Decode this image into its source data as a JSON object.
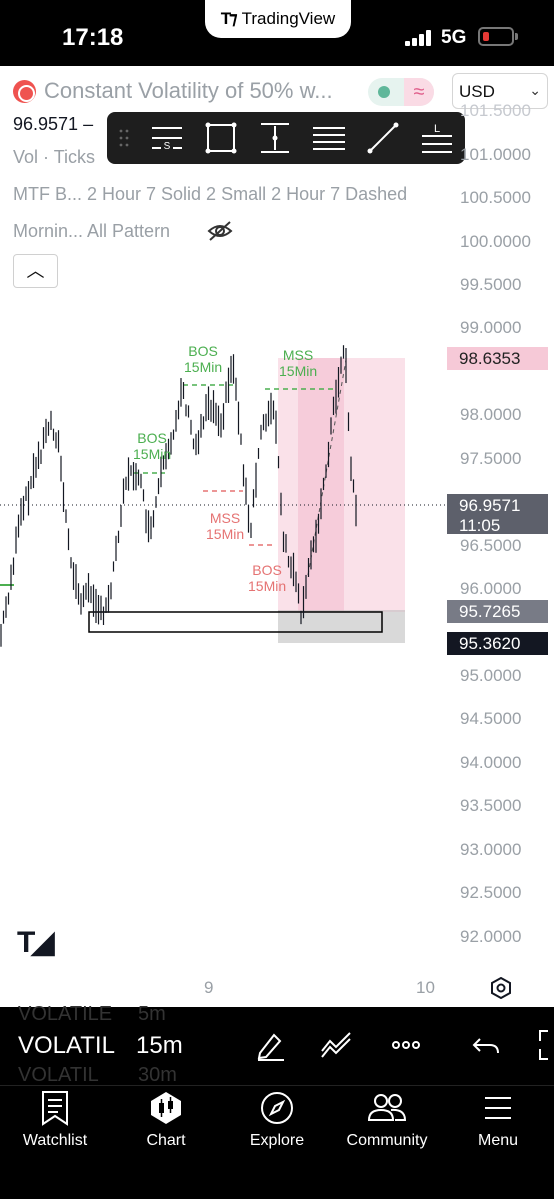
{
  "status_bar": {
    "time": "17:18",
    "network": "5G",
    "app_name": "TradingView"
  },
  "symbol": {
    "title": "Constant Volatility of 50% w...",
    "price": "96.9571",
    "price_suffix": "–",
    "volume_line": "Vol · Ticks",
    "indicator_line": "MTF B...  2 Hour 7 Solid 2 Small 2 Hour 7 Dashed",
    "indicator_line_2": "Mornin...   All Pattern"
  },
  "currency": "USD",
  "drawing_toolbar": {
    "tools": [
      "horizontal-lines-s-icon",
      "rectangle-icon",
      "vertical-range-icon",
      "parallel-lines-icon",
      "trend-line-icon",
      "horizontal-lines-l-icon"
    ]
  },
  "price_axis": {
    "labels": [
      "101.0000",
      "100.5000",
      "100.0000",
      "99.5000",
      "99.0000",
      "98.0000",
      "97.5000",
      "96.5000",
      "96.0000",
      "95.0000",
      "94.5000",
      "94.0000",
      "93.5000",
      "93.0000",
      "92.5000",
      "92.0000"
    ],
    "partial_top": "101.5000"
  },
  "price_tags": {
    "high": "98.6353",
    "current": "96.9571",
    "countdown": "11:05",
    "level_a": "95.7265",
    "level_b": "95.3620"
  },
  "time_axis": [
    "9",
    "10"
  ],
  "annotations": {
    "bos_1": [
      "BOS",
      "15Min"
    ],
    "bos_2": [
      "BOS",
      "15Min"
    ],
    "mss_green": [
      "MSS",
      "15Min"
    ],
    "mss_red": [
      "MSS",
      "15Min"
    ],
    "bos_red": [
      "BOS",
      "15Min"
    ]
  },
  "bottom_toolbar": {
    "symbol_short": "VOLATIL",
    "interval": "15m",
    "ghost_above": "VOLATILE",
    "ghost_above_interval": "5m",
    "ghost_below": "VOLATIL",
    "ghost_below_interval": "30m"
  },
  "nav": [
    {
      "label": "Watchlist",
      "icon": "watchlist-icon"
    },
    {
      "label": "Chart",
      "icon": "chart-icon"
    },
    {
      "label": "Explore",
      "icon": "compass-icon"
    },
    {
      "label": "Community",
      "icon": "community-icon"
    },
    {
      "label": "Menu",
      "icon": "menu-icon"
    }
  ],
  "colors": {
    "accent_green": "#4caf50",
    "accent_red": "#e57373",
    "pink_zone": "#f8d7e1",
    "candle": "#131722"
  }
}
